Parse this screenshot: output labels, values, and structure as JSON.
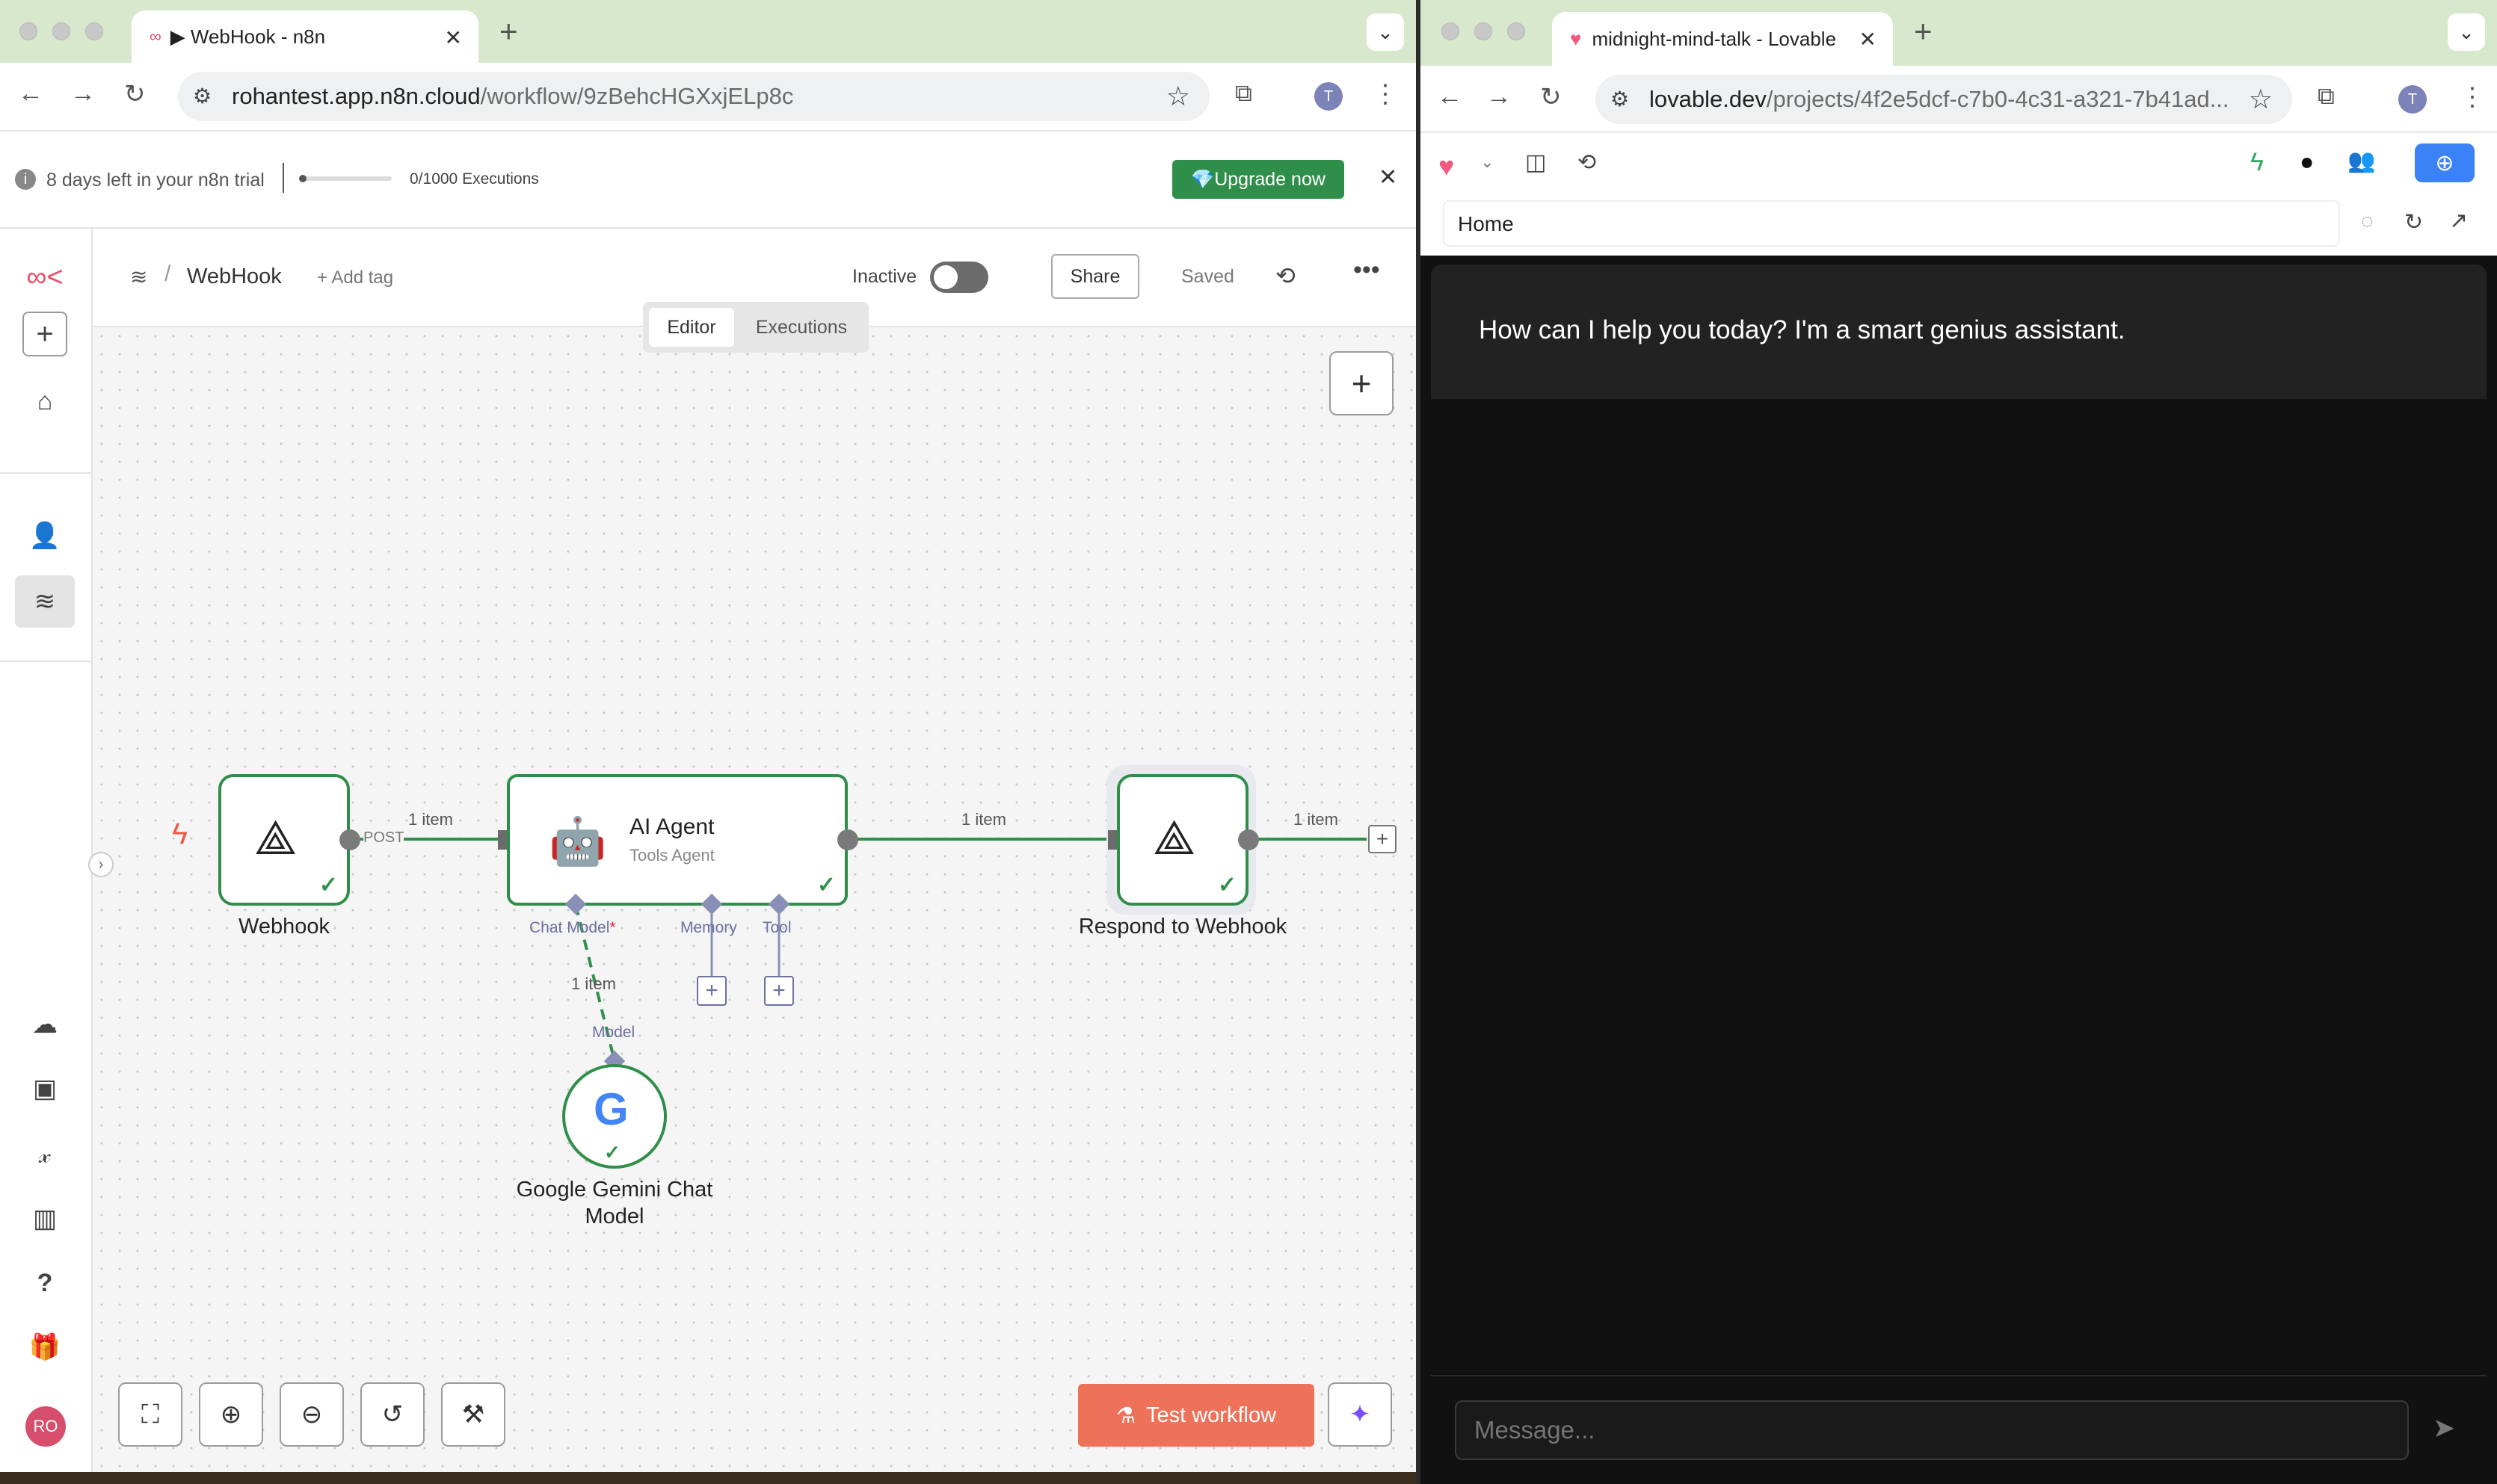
{
  "left_window": {
    "tab_title": "▶ WebHook - n8n",
    "url_host": "rohantest.app.n8n.cloud",
    "url_path": "/workflow/9zBehcHGXxjELp8c",
    "profile_initial": "T"
  },
  "trial_bar": {
    "text": "8 days left in your n8n trial",
    "executions": "0/1000 Executions",
    "executions_progress": 0,
    "upgrade_label": "💎Upgrade now"
  },
  "sidebar": {
    "user_initials": "RO"
  },
  "workflow_header": {
    "name": "WebHook",
    "add_tag": "+ Add tag",
    "status_label": "Inactive",
    "share_label": "Share",
    "saved_label": "Saved",
    "tabs": [
      "Editor",
      "Executions"
    ]
  },
  "nodes": {
    "webhook": {
      "label": "Webhook",
      "method": "POST"
    },
    "agent": {
      "title": "AI Agent",
      "subtitle": "Tools Agent",
      "ports": [
        "Chat Model",
        "Memory",
        "Tool"
      ],
      "required_mark": "*"
    },
    "respond": {
      "label": "Respond to Webhook"
    },
    "gemini": {
      "label_line1": "Google Gemini Chat",
      "label_line2": "Model",
      "port": "Model"
    }
  },
  "edges": {
    "webhook_to_agent": "1 item",
    "agent_to_respond": "1 item",
    "respond_out": "1 item",
    "model_link": "1 item"
  },
  "canvas_controls": {
    "test_workflow_label": "Test workflow"
  },
  "right_window": {
    "tab_title": "midnight-mind-talk - Lovable",
    "url_host": "lovable.dev",
    "url_path": "/projects/4f2e5dcf-c7b0-4c31-a321-7b41ad...",
    "profile_initial": "T",
    "page_path": "Home",
    "assistant_message": "How can I help you today? I'm a smart genius assistant.",
    "message_placeholder": "Message..."
  },
  "colors": {
    "n8n_green": "#2f8f4a",
    "test_button": "#ee7159",
    "tab_bar": "#d7e8cc",
    "lovable_blue": "#3b82f6"
  }
}
